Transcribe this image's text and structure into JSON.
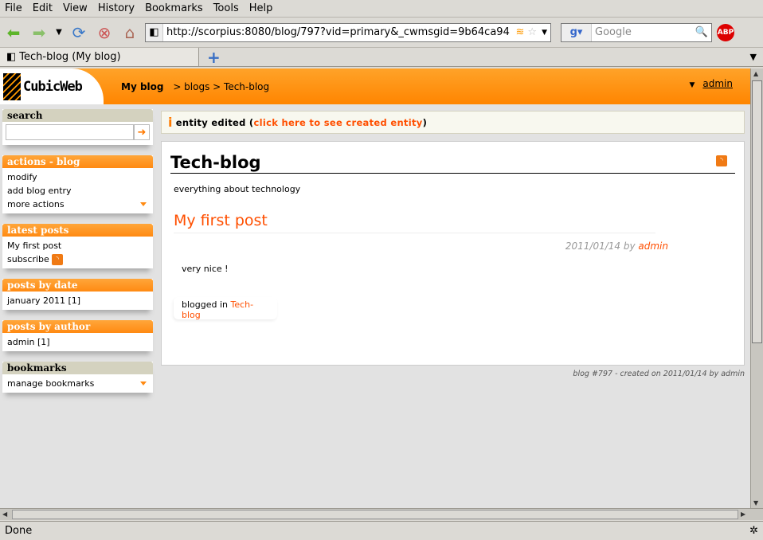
{
  "browser": {
    "menu": [
      "File",
      "Edit",
      "View",
      "History",
      "Bookmarks",
      "Tools",
      "Help"
    ],
    "url": "http://scorpius:8080/blog/797?vid=primary&_cwmsgid=9b64ca94",
    "search_placeholder": "Google",
    "tab_title": "Tech-blog (My blog)",
    "status": "Done"
  },
  "header": {
    "logo": "CubicWeb",
    "site": "My blog",
    "breadcrumb": "> blogs > Tech-blog",
    "user": "admin"
  },
  "sidebar": {
    "search_title": "search",
    "actions": {
      "title": "actions - blog",
      "items": [
        "modify",
        "add blog entry",
        "more actions"
      ]
    },
    "latest": {
      "title": "latest posts",
      "items": [
        "My first post",
        "subscribe"
      ]
    },
    "by_date": {
      "title": "posts by date",
      "items": [
        "january 2011 [1]"
      ]
    },
    "by_author": {
      "title": "posts by author",
      "items": [
        "admin [1]"
      ]
    },
    "bookmarks": {
      "title": "bookmarks",
      "items": [
        "manage bookmarks"
      ]
    }
  },
  "message": {
    "text": "entity edited (",
    "link": "click here to see created entity",
    "close": ")"
  },
  "main": {
    "title": "Tech-blog",
    "description": "everything about technology",
    "post": {
      "title": "My first post",
      "date": "2011/01/14 by",
      "author": "admin",
      "body": "very nice !",
      "blogged_in": "blogged in",
      "blog_link": "Tech-blog"
    },
    "footer": "blog #797 - created on 2011/01/14 by admin"
  },
  "colors": {
    "accent": "#ff8a12",
    "link": "#ff4f00"
  }
}
